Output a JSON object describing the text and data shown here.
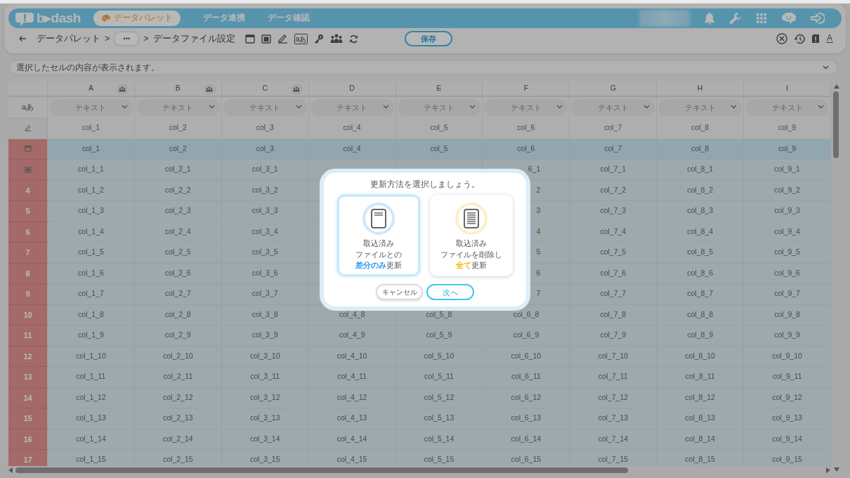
{
  "header": {
    "logo_text": "b▸dash",
    "nav": [
      {
        "label": "データパレット",
        "selected": true
      },
      {
        "label": "データ連携",
        "selected": false
      },
      {
        "label": "データ確認",
        "selected": false
      }
    ]
  },
  "toolbar": {
    "breadcrumb": [
      {
        "kind": "link",
        "label": "データパレット"
      },
      {
        "kind": "sep",
        "label": ">"
      },
      {
        "kind": "more",
        "label": "•••"
      },
      {
        "kind": "sep",
        "label": ">"
      },
      {
        "kind": "current",
        "label": "データファイル設定"
      }
    ],
    "type_icon_text": "aあ",
    "save": "保存",
    "font_icon_text": "A"
  },
  "cell_preview": {
    "placeholder": "選択したセルの内容が表示されます。"
  },
  "table": {
    "type_row_label": "aあ",
    "columns": [
      {
        "label": "A",
        "grouped": true,
        "type": "テキスト"
      },
      {
        "label": "B",
        "grouped": true,
        "type": "テキスト"
      },
      {
        "label": "C",
        "grouped": true,
        "type": "テキスト"
      },
      {
        "label": "D",
        "grouped": false,
        "type": "テキスト"
      },
      {
        "label": "E",
        "grouped": false,
        "type": "テキスト"
      },
      {
        "label": "F",
        "grouped": false,
        "type": "テキスト"
      },
      {
        "label": "G",
        "grouped": false,
        "type": "テキスト"
      },
      {
        "label": "H",
        "grouped": false,
        "type": "テキスト"
      },
      {
        "label": "I",
        "grouped": false,
        "type": "テキスト"
      }
    ],
    "rows": [
      {
        "kind": "name",
        "flagged": false,
        "selected": false,
        "cells": [
          "col_1",
          "col_2",
          "col_3",
          "col_4",
          "col_5",
          "col_6",
          "col_7",
          "col_8",
          "col_9"
        ]
      },
      {
        "kind": "header",
        "flagged": true,
        "selected": true,
        "cells": [
          "col_1",
          "col_2",
          "col_3",
          "col_4",
          "col_5",
          "col_6",
          "col_7",
          "col_8",
          "col_9"
        ]
      },
      {
        "kind": "first",
        "flagged": true,
        "selected": false,
        "cells": [
          "col_1_1",
          "col_2_1",
          "col_3_1",
          null,
          null,
          {
            "text": "6_1",
            "cut": true
          },
          "col_7_1",
          "col_8_1",
          "col_9_1"
        ]
      },
      {
        "kind": "data",
        "label": "4",
        "flagged": true,
        "selected": false,
        "cells": [
          "col_1_2",
          "col_2_2",
          "col_3_2",
          null,
          null,
          {
            "text": "2",
            "cut": true
          },
          "col_7_2",
          "col_8_2",
          "col_9_2"
        ]
      },
      {
        "kind": "data",
        "label": "5",
        "flagged": true,
        "selected": false,
        "cells": [
          "col_1_3",
          "col_2_3",
          "col_3_3",
          null,
          null,
          {
            "text": "3",
            "cut": true
          },
          "col_7_3",
          "col_8_3",
          "col_9_3"
        ]
      },
      {
        "kind": "data",
        "label": "6",
        "flagged": true,
        "selected": false,
        "cells": [
          "col_1_4",
          "col_2_4",
          "col_3_4",
          null,
          null,
          {
            "text": "4",
            "cut": true
          },
          "col_7_4",
          "col_8_4",
          "col_9_4"
        ]
      },
      {
        "kind": "data",
        "label": "7",
        "flagged": true,
        "selected": false,
        "cells": [
          "col_1_5",
          "col_2_5",
          "col_3_5",
          null,
          null,
          {
            "text": "5",
            "cut": true
          },
          "col_7_5",
          "col_8_5",
          "col_9_5"
        ]
      },
      {
        "kind": "data",
        "label": "8",
        "flagged": true,
        "selected": false,
        "cells": [
          "col_1_6",
          "col_2_6",
          "col_3_6",
          null,
          null,
          {
            "text": "6",
            "cut": true
          },
          "col_7_6",
          "col_8_6",
          "col_9_6"
        ]
      },
      {
        "kind": "data",
        "label": "9",
        "flagged": true,
        "selected": false,
        "cells": [
          "col_1_7",
          "col_2_7",
          "col_3_7",
          null,
          null,
          {
            "text": "7",
            "cut": true
          },
          "col_7_7",
          "col_8_7",
          "col_9_7"
        ]
      },
      {
        "kind": "data",
        "label": "10",
        "flagged": true,
        "selected": false,
        "cells": [
          "col_1_8",
          "col_2_8",
          "col_3_8",
          "col_4_8",
          "col_5_8",
          "col_6_8",
          "col_7_8",
          "col_8_8",
          "col_9_8"
        ]
      },
      {
        "kind": "data",
        "label": "11",
        "flagged": true,
        "selected": false,
        "cells": [
          "col_1_9",
          "col_2_9",
          "col_3_9",
          "col_4_9",
          "col_5_9",
          "col_6_9",
          "col_7_9",
          "col_8_9",
          "col_9_9"
        ]
      },
      {
        "kind": "data",
        "label": "12",
        "flagged": true,
        "selected": false,
        "cells": [
          "col_1_10",
          "col_2_10",
          "col_3_10",
          "col_4_10",
          "col_5_10",
          "col_6_10",
          "col_7_10",
          "col_8_10",
          "col_9_10"
        ]
      },
      {
        "kind": "data",
        "label": "13",
        "flagged": true,
        "selected": false,
        "cells": [
          "col_1_11",
          "col_2_11",
          "col_3_11",
          "col_4_11",
          "col_5_11",
          "col_6_11",
          "col_7_11",
          "col_8_11",
          "col_9_11"
        ]
      },
      {
        "kind": "data",
        "label": "14",
        "flagged": true,
        "selected": false,
        "cells": [
          "col_1_12",
          "col_2_12",
          "col_3_12",
          "col_4_12",
          "col_5_12",
          "col_6_12",
          "col_7_12",
          "col_8_12",
          "col_9_12"
        ]
      },
      {
        "kind": "data",
        "label": "15",
        "flagged": true,
        "selected": false,
        "cells": [
          "col_1_13",
          "col_2_13",
          "col_3_13",
          "col_4_13",
          "col_5_13",
          "col_6_13",
          "col_7_13",
          "col_8_13",
          "col_9_13"
        ]
      },
      {
        "kind": "data",
        "label": "16",
        "flagged": true,
        "selected": false,
        "cells": [
          "col_1_14",
          "col_2_14",
          "col_3_14",
          "col_4_14",
          "col_5_14",
          "col_6_14",
          "col_7_14",
          "col_8_14",
          "col_9_14"
        ]
      },
      {
        "kind": "data",
        "label": "17",
        "flagged": true,
        "selected": false,
        "cells": [
          "col_1_15",
          "col_2_15",
          "col_3_15",
          "col_4_15",
          "col_5_15",
          "col_6_15",
          "col_7_15",
          "col_8_15",
          "col_9_15"
        ]
      }
    ]
  },
  "dialog": {
    "title": "更新方法を選択しましょう。",
    "options": [
      {
        "kind": "diff",
        "selected": true,
        "color": "#2196f3",
        "lines": [
          "取込済み",
          "ファイルとの",
          "**差分のみ**更新"
        ]
      },
      {
        "kind": "full",
        "selected": false,
        "color": "#f5b400",
        "lines": [
          "取込済み",
          "ファイルを削除し",
          "**全て**更新"
        ]
      }
    ],
    "cancel": "キャンセル",
    "next": "次へ"
  }
}
